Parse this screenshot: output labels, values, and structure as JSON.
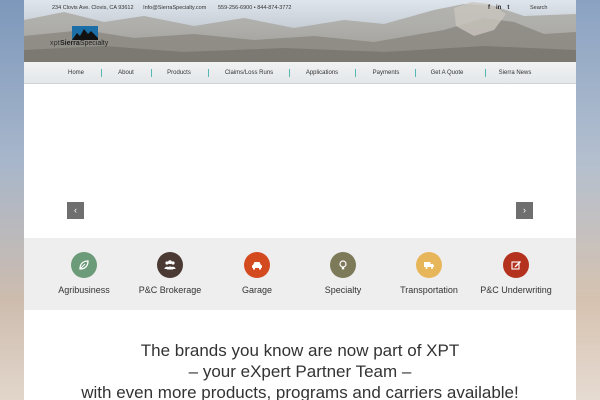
{
  "topbar": {
    "address": "234 Clovis Ave. Clovis, CA 93612",
    "email": "Info@SierraSpecialty.com",
    "phones": "559-256-6900 • 844-874-3772",
    "social": [
      "f",
      "in",
      "t"
    ],
    "search_label": "Search"
  },
  "logo": {
    "xpt": "xpt",
    "brand_bold": "Sierra",
    "brand_rest": "Specialty"
  },
  "nav": {
    "items": [
      "Home",
      "About",
      "Products",
      "Claims/Loss Runs",
      "Applications",
      "Payments",
      "Get A Quote",
      "Sierra News"
    ]
  },
  "slider": {
    "prev": "‹",
    "next": "›"
  },
  "categories": [
    {
      "label": "Agribusiness",
      "icon": "leaf-icon",
      "color": "#6c9b79"
    },
    {
      "label": "P&C Brokerage",
      "icon": "people-icon",
      "color": "#4a3a33"
    },
    {
      "label": "Garage",
      "icon": "car-icon",
      "color": "#d24a1e"
    },
    {
      "label": "Specialty",
      "icon": "lightbulb-icon",
      "color": "#7d7a5a"
    },
    {
      "label": "Transportation",
      "icon": "truck-icon",
      "color": "#e7b65a"
    },
    {
      "label": "P&C Underwriting",
      "icon": "edit-icon",
      "color": "#b4311e"
    }
  ],
  "tagline": {
    "line1": "The brands you know are now part of XPT",
    "line2": "– your eXpert Partner Team –",
    "line3": "with even more products, programs and carriers available!"
  },
  "colors": {
    "nav_separator": "#59b9b2",
    "slider_arrow": "#6f6f6f"
  }
}
